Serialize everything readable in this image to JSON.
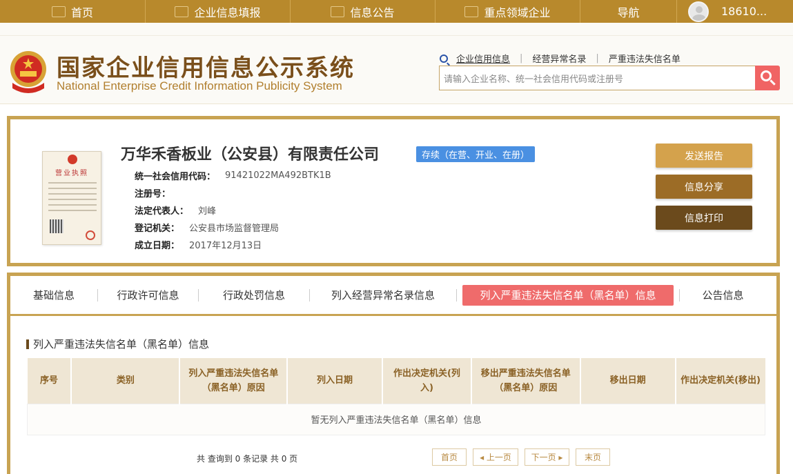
{
  "topnav": {
    "items": [
      {
        "label": "首页",
        "icon": "monitor-icon"
      },
      {
        "label": "企业信息填报",
        "icon": "edit-icon"
      },
      {
        "label": "信息公告",
        "icon": "document-icon"
      },
      {
        "label": "重点领域企业",
        "icon": "speaker-icon"
      },
      {
        "label": "导航"
      }
    ],
    "user": "18610..."
  },
  "header": {
    "title_cn": "国家企业信用信息公示系统",
    "title_en": "National Enterprise Credit Information Publicity System",
    "search_links": [
      "企业信用信息",
      "经营异常名录",
      "严重违法失信名单"
    ],
    "search_placeholder": "请输入企业名称、统一社会信用代码或注册号"
  },
  "company": {
    "name": "万华禾香板业（公安县）有限责任公司",
    "status": "存续（在营、开业、在册）",
    "license_title": "营业执照",
    "fields": [
      {
        "label": "统一社会信用代码：",
        "value": "91421022MA492BTK1B"
      },
      {
        "label": "注册号：",
        "value": ""
      },
      {
        "label": "法定代表人：",
        "value": "刘峰"
      },
      {
        "label": "登记机关：",
        "value": "公安县市场监督管理局"
      },
      {
        "label": "成立日期：",
        "value": "2017年12月13日"
      }
    ],
    "buttons": [
      "发送报告",
      "信息分享",
      "信息打印"
    ]
  },
  "tabs": [
    "基础信息",
    "行政许可信息",
    "行政处罚信息",
    "列入经营异常名录信息",
    "列入严重违法失信名单（黑名单）信息",
    "公告信息"
  ],
  "section": {
    "title": "列入严重违法失信名单（黑名单）信息",
    "columns": [
      "序号",
      "类别",
      "列入严重违法失信名单（黑名单）原因",
      "列入日期",
      "作出决定机关(列入)",
      "移出严重违法失信名单（黑名单）原因",
      "移出日期",
      "作出决定机关(移出)"
    ],
    "empty_text": "暂无列入严重违法失信名单（黑名单）信息"
  },
  "pager": {
    "count": "共 查询到 0 条记录 共 0 页",
    "first": "首页",
    "prev": "◂ 上一页",
    "next": "下一页 ▸",
    "last": "末页"
  }
}
